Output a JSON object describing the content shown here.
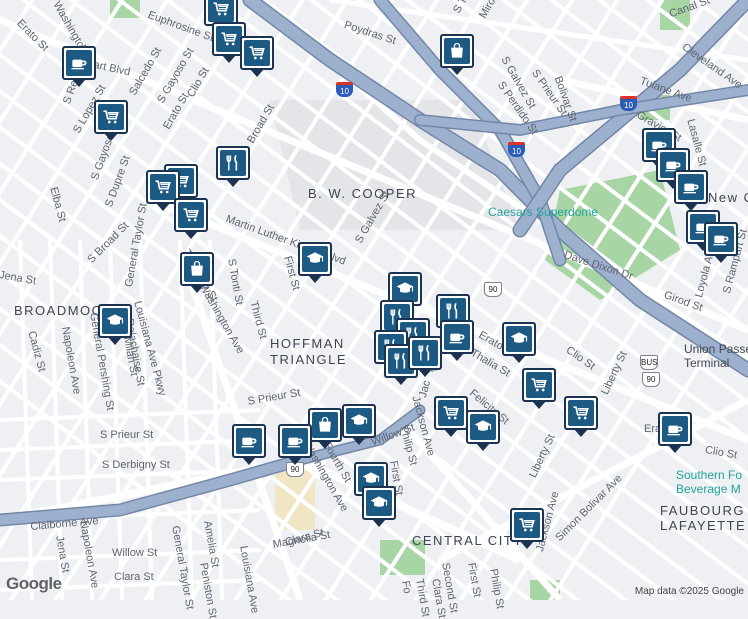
{
  "map": {
    "attribution": "Map data ©2025 Google",
    "logo_text": "Google",
    "colors": {
      "road": "#ffffff",
      "highway": "#8a9fbf",
      "background": "#eef0f3",
      "park": "#9fcf9f",
      "marker_fill": "#1c5a84",
      "marker_border": "#1b3350",
      "poi_text": "#23a39a"
    }
  },
  "neighborhoods": [
    {
      "name": "B. W. COOPER"
    },
    {
      "name": "BROADMOOR"
    },
    {
      "name": "HOFFMAN"
    },
    {
      "name": "TRIANGLE"
    },
    {
      "name": "CENTRAL CITY"
    },
    {
      "name": "FAUBOURG"
    },
    {
      "name": "LAFAYETTE"
    }
  ],
  "places": [
    {
      "name": "Caesars Superdome"
    },
    {
      "name": "Union Passenger"
    },
    {
      "name": "Terminal"
    },
    {
      "name": "Southern Fo"
    },
    {
      "name": "Beverage M"
    },
    {
      "name": "New Or"
    }
  ],
  "streets": [
    "Washington",
    "Euphrosine St",
    "Earhart Blvd",
    "Erato St",
    "Poydras St",
    "S Tonti St",
    "Miro St",
    "S Galvez St",
    "S Prieur St",
    "S Perdido St",
    "Bolivar St",
    "Canal St",
    "Cleveland Ave",
    "Tulane Ave",
    "Gravier St",
    "Lasalle St",
    "S Rendon St",
    "S Lopez St",
    "Salcedo St",
    "S Gayoso St",
    "Clio St",
    "Erato St",
    "Broad St",
    "Elba St",
    "S Gayoso St",
    "S Dupre St",
    "S Broad St",
    "General Taylor St",
    "Louisiana Ave Pkwy",
    "Delachaise St",
    "Toledano St",
    "Washington Ave",
    "S Tonti St",
    "First St",
    "Third St",
    "Martin Luther King Jr Blvd",
    "S Galvez St",
    "Girod St",
    "Dave Dixon Dr",
    "Loyola Ave",
    "S Rampart St",
    "Jena St",
    "Cadiz St",
    "Napoleon Ave",
    "General Pershing St",
    "Milan St",
    "S Prieur St",
    "S Prieur St",
    "S Derbigny St",
    "Claiborne Ave",
    "Willow St",
    "Clara St",
    "Magnolia St",
    "Fourth St",
    "Washington Ave",
    "Jackson Ave",
    "Philip St",
    "First St",
    "Felicity St",
    "Erato St",
    "Thalia St",
    "Clio St",
    "Liberty St",
    "Simon Bolivar Ave",
    "Liberty St",
    "Jackson Ave",
    "Clio St",
    "Willow St",
    "Clara St",
    "Jena St",
    "Napoleon Ave",
    "General Taylor St",
    "Amelia St",
    "Peniston St",
    "Louisiana Ave",
    "Clara St",
    "Second St",
    "First St",
    "Philip St",
    "Third St",
    "Fo",
    "Jos",
    "Jac",
    "Era"
  ],
  "route_shields": [
    {
      "label": "10",
      "kind": "interstate"
    },
    {
      "label": "10",
      "kind": "interstate"
    },
    {
      "label": "10",
      "kind": "interstate"
    },
    {
      "label": "90",
      "kind": "us"
    },
    {
      "label": "90",
      "kind": "us"
    },
    {
      "label": "90",
      "kind": "us"
    },
    {
      "label": "BUS",
      "kind": "us"
    }
  ],
  "markers": [
    {
      "type": "grocery"
    },
    {
      "type": "grocery"
    },
    {
      "type": "grocery"
    },
    {
      "type": "cafe"
    },
    {
      "type": "shopping"
    },
    {
      "type": "grocery"
    },
    {
      "type": "restaurant"
    },
    {
      "type": "grocery"
    },
    {
      "type": "grocery"
    },
    {
      "type": "grocery"
    },
    {
      "type": "school"
    },
    {
      "type": "shopping"
    },
    {
      "type": "school"
    },
    {
      "type": "school"
    },
    {
      "type": "restaurant"
    },
    {
      "type": "restaurant"
    },
    {
      "type": "restaurant"
    },
    {
      "type": "cafe"
    },
    {
      "type": "restaurant"
    },
    {
      "type": "restaurant"
    },
    {
      "type": "restaurant"
    },
    {
      "type": "school"
    },
    {
      "type": "grocery"
    },
    {
      "type": "grocery"
    },
    {
      "type": "school"
    },
    {
      "type": "grocery"
    },
    {
      "type": "shopping"
    },
    {
      "type": "school"
    },
    {
      "type": "cafe"
    },
    {
      "type": "cafe"
    },
    {
      "type": "school"
    },
    {
      "type": "school"
    },
    {
      "type": "grocery"
    },
    {
      "type": "cafe"
    },
    {
      "type": "cafe"
    },
    {
      "type": "cafe"
    },
    {
      "type": "cafe"
    },
    {
      "type": "cafe"
    },
    {
      "type": "cafe"
    }
  ]
}
